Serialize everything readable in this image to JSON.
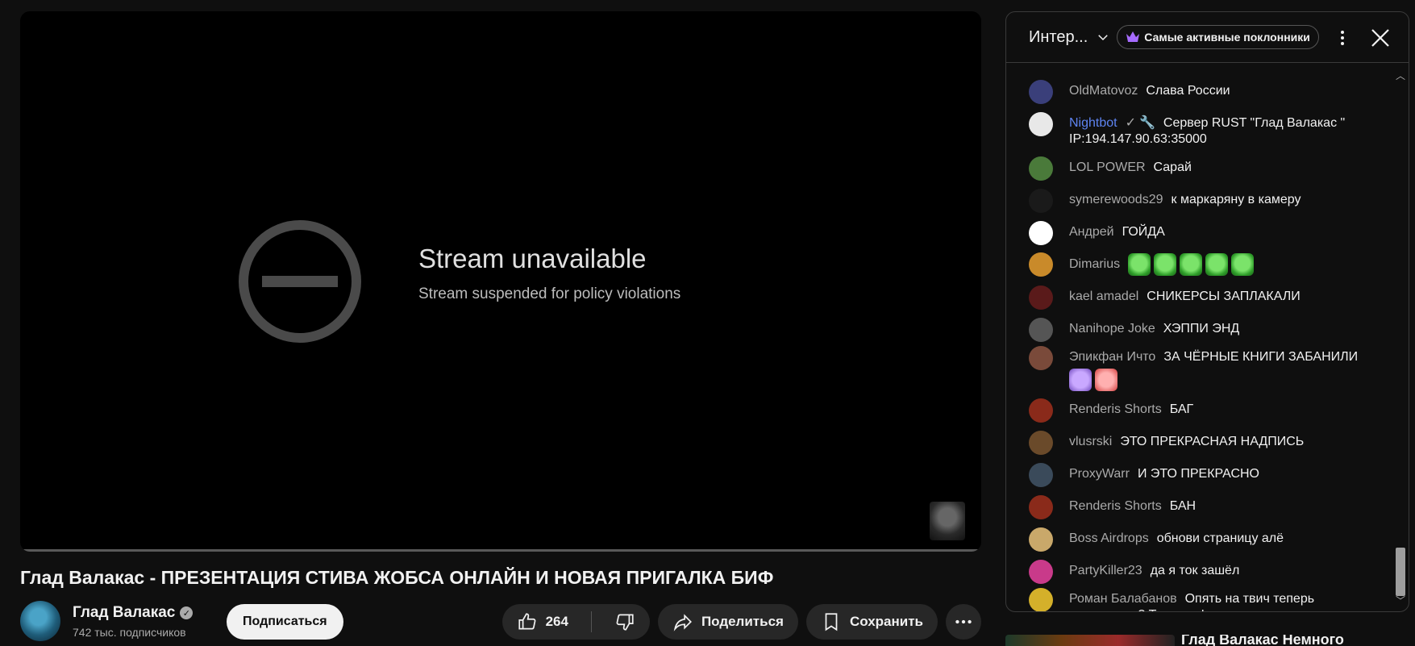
{
  "player": {
    "error_title": "Stream unavailable",
    "error_subtitle": "Stream suspended for policy violations",
    "icon": "blocked-circle-icon"
  },
  "video": {
    "title": "Глад Валакас - ПРЕЗЕНТАЦИЯ СТИВА ЖОБСА ОНЛАЙН И НОВАЯ ПРИГАЛКА БИФ"
  },
  "channel": {
    "name": "Глад Валакас",
    "subscribers": "742 тыс. подписчиков",
    "subscribe_label": "Подписаться"
  },
  "actions": {
    "likes": "264",
    "share_label": "Поделиться",
    "save_label": "Сохранить"
  },
  "chat": {
    "title": "Интер...",
    "fans_label": "Самые активные поклонники",
    "messages": [
      {
        "author": "OldMatovoz",
        "text": "Слава России",
        "color": "#3a3f7a"
      },
      {
        "author": "Nightbot",
        "text": "Сервер RUST \"Глад Валакас \" IP:194.147.90.63:35000",
        "color": "#e8e8e8"
      },
      {
        "author": "LOL POWER",
        "text": "Сарай",
        "color": "#4a7a3a"
      },
      {
        "author": "symerewoods29",
        "text": "к маркаряну в камеру",
        "color": "#1a1a1a"
      },
      {
        "author": "Андрей",
        "text": "ГОЙДА",
        "color": "#ffffff"
      },
      {
        "author": "Dimarius",
        "text": "",
        "color": "#c98a2a"
      },
      {
        "author": "kael amadel",
        "text": "СНИКЕРСЫ ЗАПЛАКАЛИ",
        "color": "#5a1a1a"
      },
      {
        "author": "Nanihope Joke",
        "text": "ХЭППИ ЭНД",
        "color": "#555555"
      },
      {
        "author": "Эпикфан Ичто",
        "text": "ЗА ЧЁРНЫЕ КНИГИ ЗАБАНИЛИ",
        "color": "#7a4a3a"
      },
      {
        "author": "Renderis Shorts",
        "text": "БАГ",
        "color": "#8a2a1a"
      },
      {
        "author": "vlusrski",
        "text": "ЭТО ПРЕКРАСНАЯ НАДПИСЬ",
        "color": "#6a4a2a"
      },
      {
        "author": "ProxyWarr",
        "text": "И ЭТО ПРЕКРАСНО",
        "color": "#3a4a5a"
      },
      {
        "author": "Renderis Shorts",
        "text": "БАН",
        "color": "#8a2a1a"
      },
      {
        "author": "Boss Airdrops",
        "text": "обнови страницу алё",
        "color": "#c9a86a"
      },
      {
        "author": "PartyKiller23",
        "text": "да я ток зашёл",
        "color": "#c93a8a"
      },
      {
        "author": "Роман Балабанов",
        "text": "Опять на твич теперь переходить? Та за шо!",
        "color": "#d4b02a"
      }
    ]
  },
  "recommendation": {
    "title": "Глад Валакас Немного"
  }
}
